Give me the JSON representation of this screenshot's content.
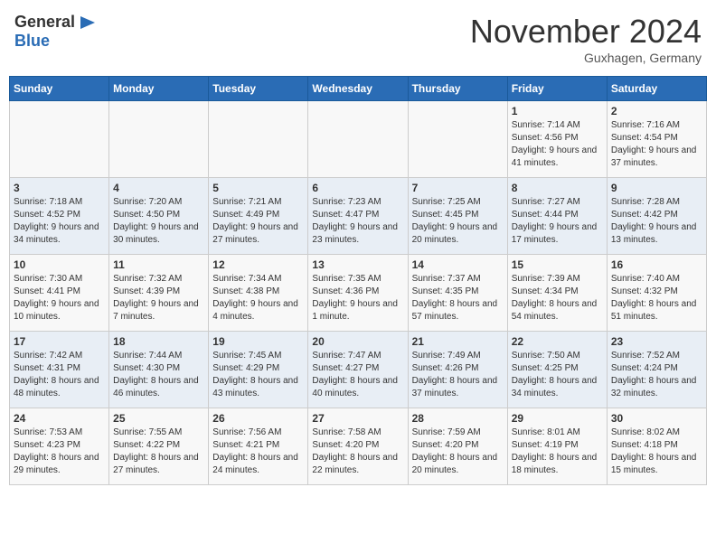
{
  "header": {
    "logo_general": "General",
    "logo_blue": "Blue",
    "month_title": "November 2024",
    "location": "Guxhagen, Germany"
  },
  "weekdays": [
    "Sunday",
    "Monday",
    "Tuesday",
    "Wednesday",
    "Thursday",
    "Friday",
    "Saturday"
  ],
  "weeks": [
    [
      {
        "day": "",
        "sunrise": "",
        "sunset": "",
        "daylight": ""
      },
      {
        "day": "",
        "sunrise": "",
        "sunset": "",
        "daylight": ""
      },
      {
        "day": "",
        "sunrise": "",
        "sunset": "",
        "daylight": ""
      },
      {
        "day": "",
        "sunrise": "",
        "sunset": "",
        "daylight": ""
      },
      {
        "day": "",
        "sunrise": "",
        "sunset": "",
        "daylight": ""
      },
      {
        "day": "1",
        "sunrise": "Sunrise: 7:14 AM",
        "sunset": "Sunset: 4:56 PM",
        "daylight": "Daylight: 9 hours and 41 minutes."
      },
      {
        "day": "2",
        "sunrise": "Sunrise: 7:16 AM",
        "sunset": "Sunset: 4:54 PM",
        "daylight": "Daylight: 9 hours and 37 minutes."
      }
    ],
    [
      {
        "day": "3",
        "sunrise": "Sunrise: 7:18 AM",
        "sunset": "Sunset: 4:52 PM",
        "daylight": "Daylight: 9 hours and 34 minutes."
      },
      {
        "day": "4",
        "sunrise": "Sunrise: 7:20 AM",
        "sunset": "Sunset: 4:50 PM",
        "daylight": "Daylight: 9 hours and 30 minutes."
      },
      {
        "day": "5",
        "sunrise": "Sunrise: 7:21 AM",
        "sunset": "Sunset: 4:49 PM",
        "daylight": "Daylight: 9 hours and 27 minutes."
      },
      {
        "day": "6",
        "sunrise": "Sunrise: 7:23 AM",
        "sunset": "Sunset: 4:47 PM",
        "daylight": "Daylight: 9 hours and 23 minutes."
      },
      {
        "day": "7",
        "sunrise": "Sunrise: 7:25 AM",
        "sunset": "Sunset: 4:45 PM",
        "daylight": "Daylight: 9 hours and 20 minutes."
      },
      {
        "day": "8",
        "sunrise": "Sunrise: 7:27 AM",
        "sunset": "Sunset: 4:44 PM",
        "daylight": "Daylight: 9 hours and 17 minutes."
      },
      {
        "day": "9",
        "sunrise": "Sunrise: 7:28 AM",
        "sunset": "Sunset: 4:42 PM",
        "daylight": "Daylight: 9 hours and 13 minutes."
      }
    ],
    [
      {
        "day": "10",
        "sunrise": "Sunrise: 7:30 AM",
        "sunset": "Sunset: 4:41 PM",
        "daylight": "Daylight: 9 hours and 10 minutes."
      },
      {
        "day": "11",
        "sunrise": "Sunrise: 7:32 AM",
        "sunset": "Sunset: 4:39 PM",
        "daylight": "Daylight: 9 hours and 7 minutes."
      },
      {
        "day": "12",
        "sunrise": "Sunrise: 7:34 AM",
        "sunset": "Sunset: 4:38 PM",
        "daylight": "Daylight: 9 hours and 4 minutes."
      },
      {
        "day": "13",
        "sunrise": "Sunrise: 7:35 AM",
        "sunset": "Sunset: 4:36 PM",
        "daylight": "Daylight: 9 hours and 1 minute."
      },
      {
        "day": "14",
        "sunrise": "Sunrise: 7:37 AM",
        "sunset": "Sunset: 4:35 PM",
        "daylight": "Daylight: 8 hours and 57 minutes."
      },
      {
        "day": "15",
        "sunrise": "Sunrise: 7:39 AM",
        "sunset": "Sunset: 4:34 PM",
        "daylight": "Daylight: 8 hours and 54 minutes."
      },
      {
        "day": "16",
        "sunrise": "Sunrise: 7:40 AM",
        "sunset": "Sunset: 4:32 PM",
        "daylight": "Daylight: 8 hours and 51 minutes."
      }
    ],
    [
      {
        "day": "17",
        "sunrise": "Sunrise: 7:42 AM",
        "sunset": "Sunset: 4:31 PM",
        "daylight": "Daylight: 8 hours and 48 minutes."
      },
      {
        "day": "18",
        "sunrise": "Sunrise: 7:44 AM",
        "sunset": "Sunset: 4:30 PM",
        "daylight": "Daylight: 8 hours and 46 minutes."
      },
      {
        "day": "19",
        "sunrise": "Sunrise: 7:45 AM",
        "sunset": "Sunset: 4:29 PM",
        "daylight": "Daylight: 8 hours and 43 minutes."
      },
      {
        "day": "20",
        "sunrise": "Sunrise: 7:47 AM",
        "sunset": "Sunset: 4:27 PM",
        "daylight": "Daylight: 8 hours and 40 minutes."
      },
      {
        "day": "21",
        "sunrise": "Sunrise: 7:49 AM",
        "sunset": "Sunset: 4:26 PM",
        "daylight": "Daylight: 8 hours and 37 minutes."
      },
      {
        "day": "22",
        "sunrise": "Sunrise: 7:50 AM",
        "sunset": "Sunset: 4:25 PM",
        "daylight": "Daylight: 8 hours and 34 minutes."
      },
      {
        "day": "23",
        "sunrise": "Sunrise: 7:52 AM",
        "sunset": "Sunset: 4:24 PM",
        "daylight": "Daylight: 8 hours and 32 minutes."
      }
    ],
    [
      {
        "day": "24",
        "sunrise": "Sunrise: 7:53 AM",
        "sunset": "Sunset: 4:23 PM",
        "daylight": "Daylight: 8 hours and 29 minutes."
      },
      {
        "day": "25",
        "sunrise": "Sunrise: 7:55 AM",
        "sunset": "Sunset: 4:22 PM",
        "daylight": "Daylight: 8 hours and 27 minutes."
      },
      {
        "day": "26",
        "sunrise": "Sunrise: 7:56 AM",
        "sunset": "Sunset: 4:21 PM",
        "daylight": "Daylight: 8 hours and 24 minutes."
      },
      {
        "day": "27",
        "sunrise": "Sunrise: 7:58 AM",
        "sunset": "Sunset: 4:20 PM",
        "daylight": "Daylight: 8 hours and 22 minutes."
      },
      {
        "day": "28",
        "sunrise": "Sunrise: 7:59 AM",
        "sunset": "Sunset: 4:20 PM",
        "daylight": "Daylight: 8 hours and 20 minutes."
      },
      {
        "day": "29",
        "sunrise": "Sunrise: 8:01 AM",
        "sunset": "Sunset: 4:19 PM",
        "daylight": "Daylight: 8 hours and 18 minutes."
      },
      {
        "day": "30",
        "sunrise": "Sunrise: 8:02 AM",
        "sunset": "Sunset: 4:18 PM",
        "daylight": "Daylight: 8 hours and 15 minutes."
      }
    ]
  ]
}
